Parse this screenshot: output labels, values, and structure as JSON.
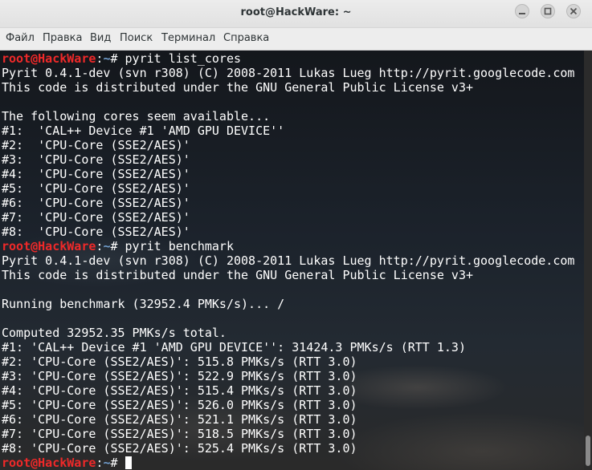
{
  "window": {
    "title": "root@HackWare: ~"
  },
  "menu": [
    "Файл",
    "Правка",
    "Вид",
    "Поиск",
    "Терминал",
    "Справка"
  ],
  "prompt": {
    "user_host": "root@HackWare",
    "sep": ":",
    "dir": "~",
    "symbol": "# "
  },
  "session": [
    {
      "type": "prompt",
      "cmd": "pyrit list_cores"
    },
    {
      "type": "out",
      "text": "Pyrit 0.4.1-dev (svn r308) (C) 2008-2011 Lukas Lueg http://pyrit.googlecode.com"
    },
    {
      "type": "out",
      "text": "This code is distributed under the GNU General Public License v3+"
    },
    {
      "type": "out",
      "text": ""
    },
    {
      "type": "out",
      "text": "The following cores seem available..."
    },
    {
      "type": "out",
      "text": "#1:  'CAL++ Device #1 'AMD GPU DEVICE''"
    },
    {
      "type": "out",
      "text": "#2:  'CPU-Core (SSE2/AES)'"
    },
    {
      "type": "out",
      "text": "#3:  'CPU-Core (SSE2/AES)'"
    },
    {
      "type": "out",
      "text": "#4:  'CPU-Core (SSE2/AES)'"
    },
    {
      "type": "out",
      "text": "#5:  'CPU-Core (SSE2/AES)'"
    },
    {
      "type": "out",
      "text": "#6:  'CPU-Core (SSE2/AES)'"
    },
    {
      "type": "out",
      "text": "#7:  'CPU-Core (SSE2/AES)'"
    },
    {
      "type": "out",
      "text": "#8:  'CPU-Core (SSE2/AES)'"
    },
    {
      "type": "prompt",
      "cmd": "pyrit benchmark"
    },
    {
      "type": "out",
      "text": "Pyrit 0.4.1-dev (svn r308) (C) 2008-2011 Lukas Lueg http://pyrit.googlecode.com"
    },
    {
      "type": "out",
      "text": "This code is distributed under the GNU General Public License v3+"
    },
    {
      "type": "out",
      "text": ""
    },
    {
      "type": "out",
      "text": "Running benchmark (32952.4 PMKs/s)... /"
    },
    {
      "type": "out",
      "text": ""
    },
    {
      "type": "out",
      "text": "Computed 32952.35 PMKs/s total."
    },
    {
      "type": "out",
      "text": "#1: 'CAL++ Device #1 'AMD GPU DEVICE'': 31424.3 PMKs/s (RTT 1.3)"
    },
    {
      "type": "out",
      "text": "#2: 'CPU-Core (SSE2/AES)': 515.8 PMKs/s (RTT 3.0)"
    },
    {
      "type": "out",
      "text": "#3: 'CPU-Core (SSE2/AES)': 522.9 PMKs/s (RTT 3.0)"
    },
    {
      "type": "out",
      "text": "#4: 'CPU-Core (SSE2/AES)': 515.4 PMKs/s (RTT 3.0)"
    },
    {
      "type": "out",
      "text": "#5: 'CPU-Core (SSE2/AES)': 526.0 PMKs/s (RTT 3.0)"
    },
    {
      "type": "out",
      "text": "#6: 'CPU-Core (SSE2/AES)': 521.1 PMKs/s (RTT 3.0)"
    },
    {
      "type": "out",
      "text": "#7: 'CPU-Core (SSE2/AES)': 518.5 PMKs/s (RTT 3.0)"
    },
    {
      "type": "out",
      "text": "#8: 'CPU-Core (SSE2/AES)': 525.4 PMKs/s (RTT 3.0)"
    },
    {
      "type": "prompt",
      "cmd": "",
      "cursor": true
    }
  ]
}
